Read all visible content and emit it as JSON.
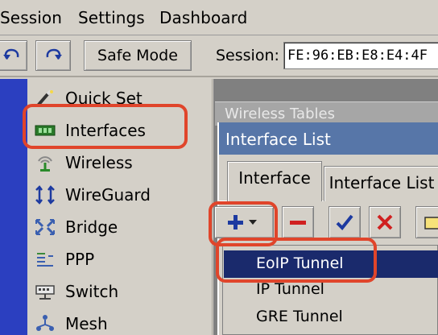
{
  "menu": [
    "Session",
    "Settings",
    "Dashboard"
  ],
  "toolbar": {
    "undo_icon": "undo-icon",
    "redo_icon": "redo-icon",
    "safe_mode_label": "Safe Mode",
    "session_label": "Session:",
    "session_value": "FE:96:EB:E8:E4:4F"
  },
  "sidebar": {
    "items": [
      {
        "label": "Quick Set",
        "icon": "wand-icon"
      },
      {
        "label": "Interfaces",
        "icon": "network-card-icon"
      },
      {
        "label": "Wireless",
        "icon": "wireless-icon"
      },
      {
        "label": "WireGuard",
        "icon": "wireguard-icon"
      },
      {
        "label": "Bridge",
        "icon": "bridge-icon"
      },
      {
        "label": "PPP",
        "icon": "ppp-icon"
      },
      {
        "label": "Switch",
        "icon": "switch-icon"
      },
      {
        "label": "Mesh",
        "icon": "mesh-icon"
      }
    ]
  },
  "background_window": {
    "title": "Wireless Tables"
  },
  "window": {
    "title": "Interface List",
    "tabs": [
      "Interface",
      "Interface List"
    ]
  },
  "dropdown": {
    "items": [
      "EoIP Tunnel",
      "IP Tunnel",
      "GRE Tunnel"
    ],
    "selected": "EoIP Tunnel"
  },
  "colors": {
    "title_bar": "#5776a8",
    "selected_item": "#1a2a6c",
    "annotation": "#e0452b",
    "left_strip": "#2b3fc0"
  }
}
